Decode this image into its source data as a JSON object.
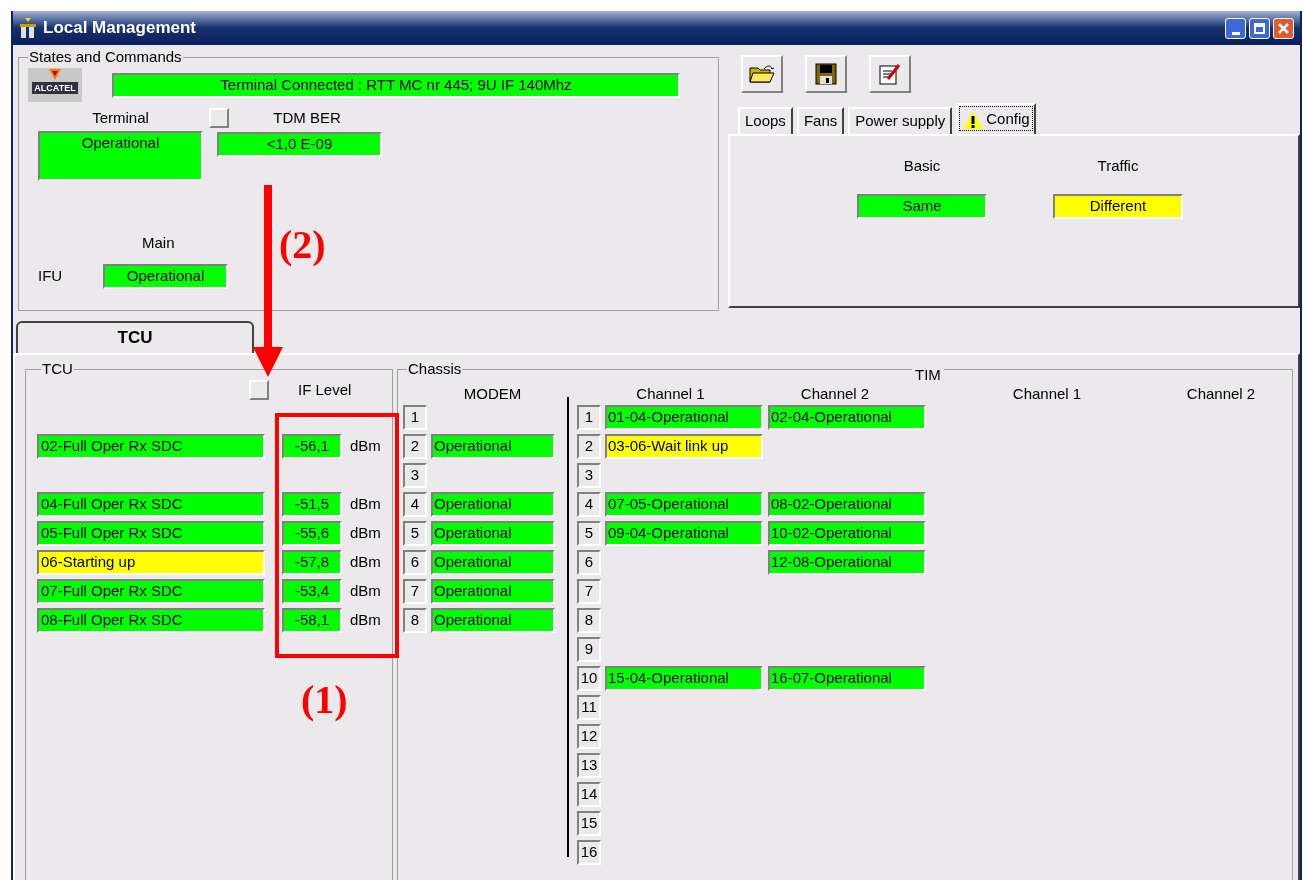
{
  "window": {
    "title": "Local Management"
  },
  "states_and_commands": {
    "title": "States and Commands",
    "logo_text": "ALCATEL",
    "connection": {
      "value": "Terminal Connected  : RTT MC nr 445;  9U IF 140Mhz",
      "color": "#00ff00"
    },
    "terminal": {
      "label": "Terminal",
      "value": "Operational",
      "color": "#00ff00"
    },
    "tdm_ber": {
      "label": "TDM BER",
      "value": "<1,0 E-09",
      "color": "#00ff00",
      "checked": false
    },
    "main_label": "Main",
    "ifu": {
      "label": "IFU",
      "value": "Operational",
      "color": "#00ff00"
    }
  },
  "tabs": [
    {
      "label": "Loops",
      "selected": false,
      "warning": false
    },
    {
      "label": "Fans",
      "selected": false,
      "warning": false
    },
    {
      "label": "Power supply",
      "selected": false,
      "warning": false
    },
    {
      "label": "Config",
      "selected": true,
      "warning": true
    }
  ],
  "config": [
    {
      "label": "Basic",
      "value": "Same",
      "color": "#00ff00"
    },
    {
      "label": "Traffic",
      "value": "Different",
      "color": "#ffff00"
    }
  ],
  "main_tabs": [
    {
      "label": "TCU",
      "selected": true
    }
  ],
  "tcu": {
    "title": "TCU",
    "checked": false,
    "if_level_label": "IF Level",
    "rows": [
      null,
      {
        "status": "02-Full Oper Rx SDC",
        "color": "#00ff00",
        "if_level": "-56,1",
        "unit": "dBm"
      },
      null,
      {
        "status": "04-Full Oper Rx SDC",
        "color": "#00ff00",
        "if_level": "-51,5",
        "unit": "dBm"
      },
      {
        "status": "05-Full Oper Rx SDC",
        "color": "#00ff00",
        "if_level": "-55,6",
        "unit": "dBm"
      },
      {
        "status": "06-Starting up",
        "color": "#ffff00",
        "if_level": "-57,8",
        "unit": "dBm"
      },
      {
        "status": "07-Full Oper Rx SDC",
        "color": "#00ff00",
        "if_level": "-53,4",
        "unit": "dBm"
      },
      {
        "status": "08-Full Oper Rx SDC",
        "color": "#00ff00",
        "if_level": "-58,1",
        "unit": "dBm"
      }
    ]
  },
  "chassis": {
    "title": "Chassis",
    "modem_label": "MODEM",
    "modems": [
      {
        "slot": "1"
      },
      {
        "slot": "2",
        "status": "Operational",
        "color": "#00ff00"
      },
      {
        "slot": "3"
      },
      {
        "slot": "4",
        "status": "Operational",
        "color": "#00ff00"
      },
      {
        "slot": "5",
        "status": "Operational",
        "color": "#00ff00"
      },
      {
        "slot": "6",
        "status": "Operational",
        "color": "#00ff00"
      },
      {
        "slot": "7",
        "status": "Operational",
        "color": "#00ff00"
      },
      {
        "slot": "8",
        "status": "Operational",
        "color": "#00ff00"
      }
    ]
  },
  "tim": {
    "title": "TIM",
    "columns": [
      "Channel 1",
      "Channel 2",
      "Channel 1",
      "Channel 2"
    ],
    "rows": [
      {
        "slot": "1",
        "channel_1": {
          "value": "01-04-Operational",
          "color": "#00ff00"
        },
        "channel_2": {
          "value": "02-04-Operational",
          "color": "#00ff00"
        }
      },
      {
        "slot": "2",
        "channel_1": {
          "value": "03-06-Wait link up",
          "color": "#ffff00"
        }
      },
      {
        "slot": "3"
      },
      {
        "slot": "4",
        "channel_1": {
          "value": "07-05-Operational",
          "color": "#00ff00"
        },
        "channel_2": {
          "value": "08-02-Operational",
          "color": "#00ff00"
        }
      },
      {
        "slot": "5",
        "channel_1": {
          "value": "09-04-Operational",
          "color": "#00ff00"
        },
        "channel_2": {
          "value": "10-02-Operational",
          "color": "#00ff00"
        }
      },
      {
        "slot": "6",
        "channel_2": {
          "value": "12-08-Operational",
          "color": "#00ff00"
        }
      },
      {
        "slot": "7"
      },
      {
        "slot": "8"
      },
      {
        "slot": "9"
      },
      {
        "slot": "10",
        "channel_1": {
          "value": "15-04-Operational",
          "color": "#00ff00"
        },
        "channel_2": {
          "value": "16-07-Operational",
          "color": "#00ff00"
        }
      },
      {
        "slot": "11"
      },
      {
        "slot": "12"
      },
      {
        "slot": "13"
      },
      {
        "slot": "14"
      },
      {
        "slot": "15"
      },
      {
        "slot": "16"
      }
    ]
  },
  "annotations": [
    {
      "label": "(2)"
    },
    {
      "label": "(1)"
    }
  ]
}
